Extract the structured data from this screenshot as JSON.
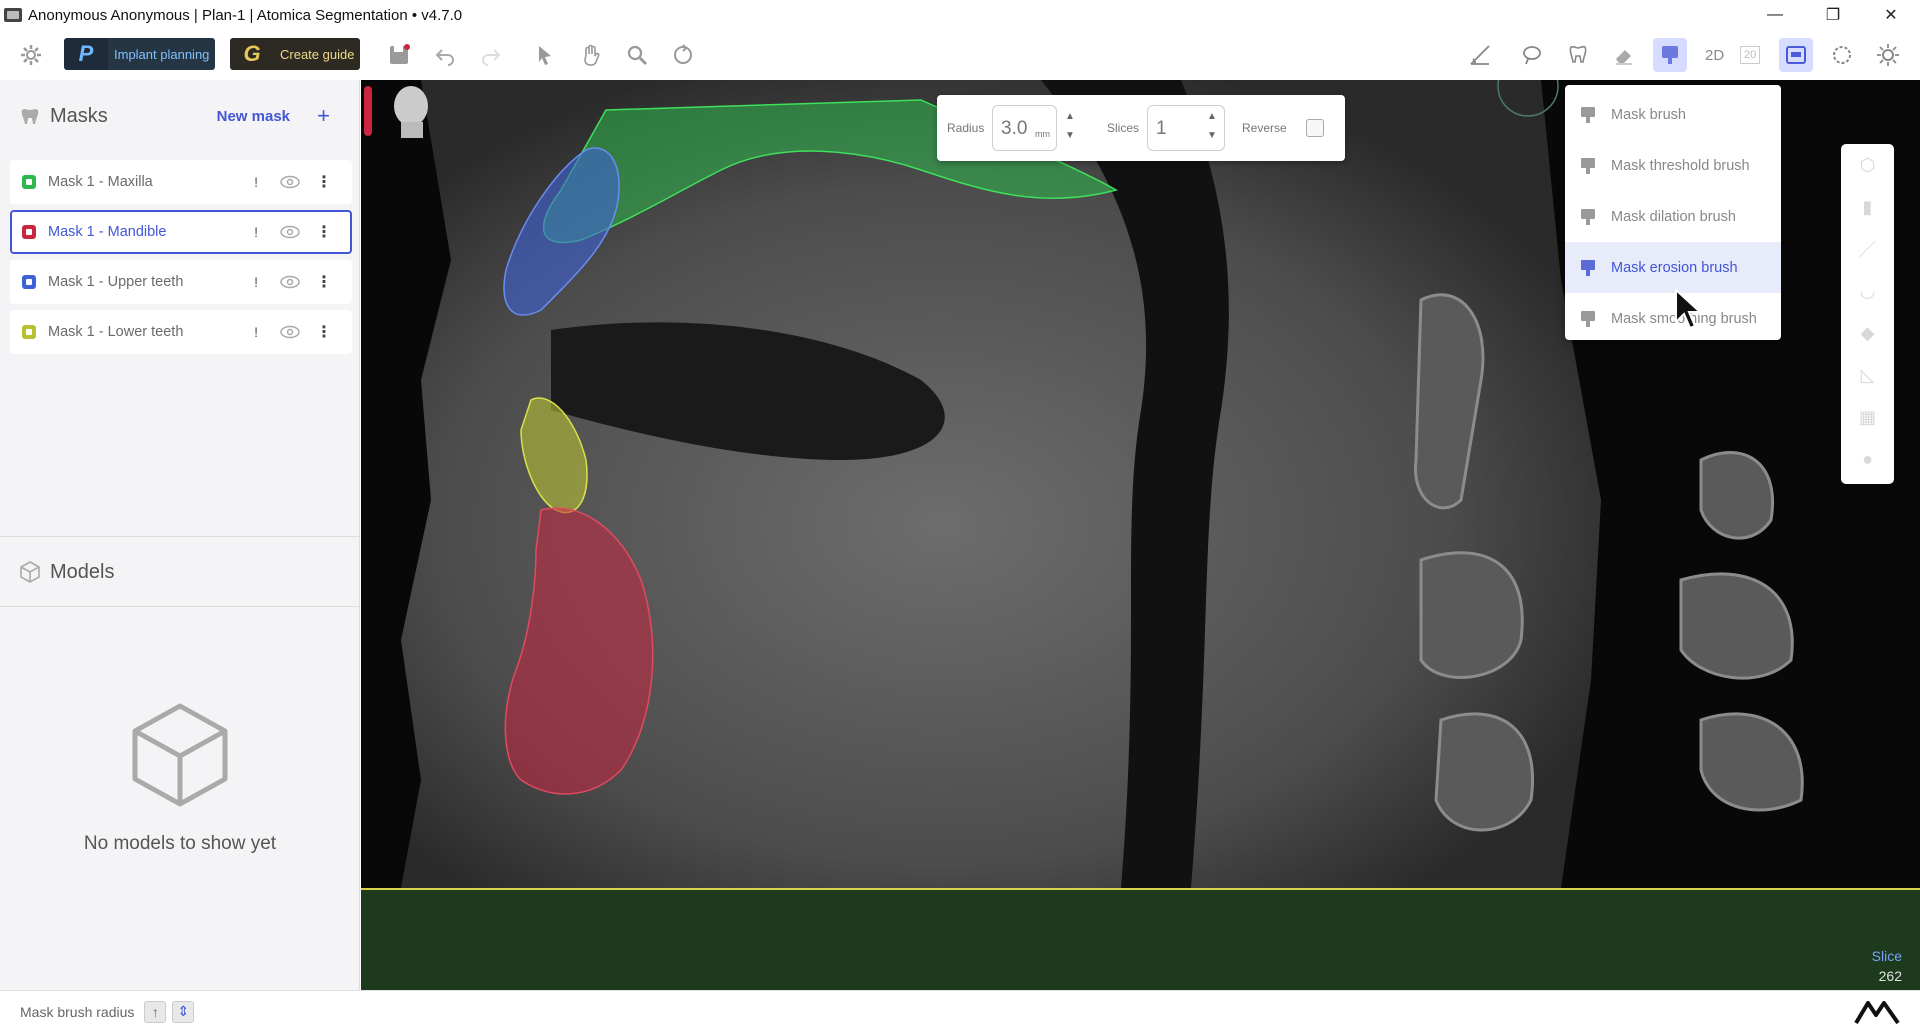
{
  "window": {
    "title": "Anonymous Anonymous | Plan-1 | Atomica Segmentation • v4.7.0",
    "controls": {
      "minimize": "—",
      "restore": "❐",
      "close": "✕"
    }
  },
  "toolbar": {
    "implant_logo": "P",
    "implant_label": "Implant planning",
    "guide_logo": "G",
    "guide_label": "Create guide",
    "view_2d": "2D",
    "view_20": "20"
  },
  "masks_panel": {
    "title": "Masks",
    "new_mask_label": "New mask",
    "add_icon": "+",
    "items": [
      {
        "label": "Mask 1 - Maxilla",
        "color": "#2db84c",
        "warning": "!"
      },
      {
        "label": "Mask 1 - Mandible",
        "color": "#c8273f",
        "warning": "!"
      },
      {
        "label": "Mask 1 - Upper teeth",
        "color": "#3f63d6",
        "warning": "!"
      },
      {
        "label": "Mask 1 - Lower teeth",
        "color": "#b8c035",
        "warning": "!"
      }
    ],
    "more_icon": "⋮"
  },
  "models_panel": {
    "title": "Models",
    "empty_text": "No models to show yet"
  },
  "brush_options": {
    "radius_label": "Radius",
    "radius_value": "3.0",
    "radius_unit": "mm",
    "slices_label": "Slices",
    "slices_value": "1",
    "reverse_label": "Reverse"
  },
  "brush_menu": {
    "items": [
      {
        "label": "Mask brush"
      },
      {
        "label": "Mask threshold brush"
      },
      {
        "label": "Mask dilation brush"
      },
      {
        "label": "Mask erosion brush"
      },
      {
        "label": "Mask smoothing brush"
      }
    ]
  },
  "viewer": {
    "slice_label": "Slice",
    "slice_value": "262"
  },
  "statusbar": {
    "hint": "Mask brush radius",
    "key_up": "↑",
    "key_down": "⇕"
  },
  "colors": {
    "accent": "#4256d6",
    "maxilla": "#2db84c",
    "mandible": "#c8273f",
    "upper_teeth": "#3f63d6",
    "lower_teeth": "#b8c035"
  }
}
